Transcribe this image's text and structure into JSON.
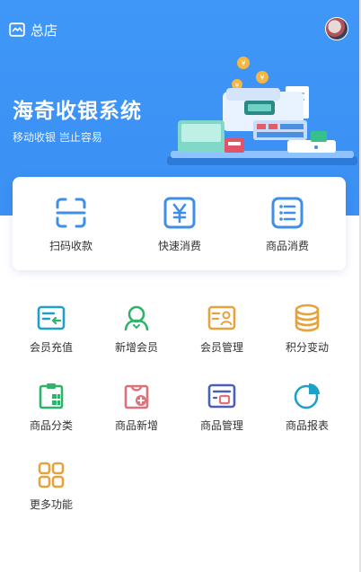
{
  "header": {
    "store_label": "总店",
    "store_icon": "store-icon",
    "avatar": "user-avatar"
  },
  "hero": {
    "title": "海奇收银系统",
    "subtitle": "移动收银  岂止容易",
    "colors": {
      "primary": "#3f97f7",
      "text": "#ffffff"
    }
  },
  "quick_actions": [
    {
      "label": "扫码收款",
      "icon": "scan-icon"
    },
    {
      "label": "快速消费",
      "icon": "yuan-icon"
    },
    {
      "label": "商品消费",
      "icon": "list-icon"
    }
  ],
  "menu": [
    {
      "label": "会员充值",
      "icon": "member-recharge-icon",
      "color": "#1fa0c9"
    },
    {
      "label": "新增会员",
      "icon": "add-member-icon",
      "color": "#2fb36b"
    },
    {
      "label": "会员管理",
      "icon": "member-card-icon",
      "color": "#e6a23c"
    },
    {
      "label": "积分变动",
      "icon": "points-icon",
      "color": "#e6a23c"
    },
    {
      "label": "商品分类",
      "icon": "category-icon",
      "color": "#2fb36b"
    },
    {
      "label": "商品新增",
      "icon": "add-product-icon",
      "color": "#e0707a"
    },
    {
      "label": "商品管理",
      "icon": "product-manage-icon",
      "color": "#4a5fb5"
    },
    {
      "label": "商品报表",
      "icon": "report-pie-icon",
      "color": "#1fa0c9"
    },
    {
      "label": "更多功能",
      "icon": "more-grid-icon",
      "color": "#e6a23c"
    }
  ]
}
